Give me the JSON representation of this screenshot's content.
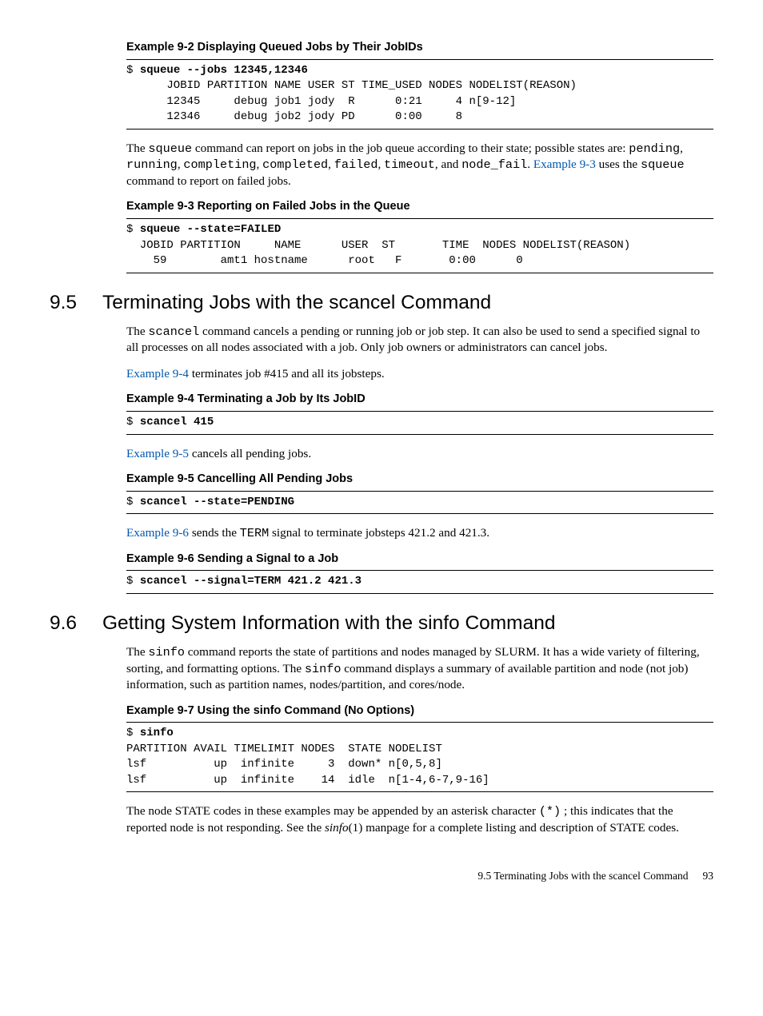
{
  "ex92": {
    "title": "Example 9-2  Displaying Queued Jobs by Their JobIDs",
    "cmd": "squeue --jobs 12345,12346",
    "out": "      JOBID PARTITION NAME USER ST TIME_USED NODES NODELIST(REASON)\n      12345     debug job1 jody  R      0:21     4 n[9-12]\n      12346     debug job2 jody PD      0:00     8"
  },
  "p_squeue_states": {
    "pre": "The ",
    "cmd1": "squeue",
    "mid1": " command can report on jobs in the job queue according to their state; possible states are: ",
    "s1": "pending",
    "s2": "running",
    "s3": "completing",
    "s4": "completed",
    "s5": "failed",
    "s6": "timeout",
    "s7": "node_fail",
    "mid2": ". ",
    "link": "Example 9-3",
    "mid3": " uses the ",
    "cmd2": "squeue",
    "tail": " command to report on failed jobs."
  },
  "ex93": {
    "title": "Example 9-3  Reporting on Failed Jobs in the Queue",
    "cmd": "squeue --state=FAILED",
    "out": "  JOBID PARTITION     NAME      USER  ST       TIME  NODES NODELIST(REASON)\n    59        amt1 hostname      root   F       0:00      0"
  },
  "sec95": {
    "num": "9.5",
    "title": "Terminating Jobs with the scancel Command"
  },
  "p_scancel_intro": {
    "pre": "The ",
    "cmd": "scancel",
    "tail": " command cancels a pending or running job or job step. It can also be used to send a specified signal to all processes on all nodes associated with a job. Only job owners or administrators can cancel jobs."
  },
  "p_ex94_ref": {
    "link": "Example 9-4",
    "tail": " terminates job #415 and all its jobsteps."
  },
  "ex94": {
    "title": "Example 9-4  Terminating a Job by Its JobID",
    "cmd": "scancel 415"
  },
  "p_ex95_ref": {
    "link": "Example 9-5",
    "tail": " cancels all pending jobs."
  },
  "ex95": {
    "title": "Example 9-5  Cancelling All Pending Jobs",
    "cmd": "scancel --state=PENDING"
  },
  "p_ex96_ref": {
    "link": "Example 9-6",
    "mid": " sends the ",
    "cmd": "TERM",
    "tail": " signal to terminate jobsteps 421.2 and 421.3."
  },
  "ex96": {
    "title": "Example 9-6  Sending a Signal to a Job",
    "cmd": "scancel --signal=TERM 421.2 421.3"
  },
  "sec96": {
    "num": "9.6",
    "title": "Getting System Information with the sinfo Command"
  },
  "p_sinfo_intro": {
    "pre": "The ",
    "cmd1": "sinfo",
    "mid": " command reports the state of partitions and nodes managed by SLURM. It has a wide variety of filtering, sorting, and formatting options. The ",
    "cmd2": "sinfo",
    "tail": " command displays a summary of available partition and node (not job) information, such as partition names, nodes/partition, and cores/node."
  },
  "ex97": {
    "title": "Example 9-7  Using the sinfo Command (No Options)",
    "cmd": "sinfo",
    "out": "PARTITION AVAIL TIMELIMIT NODES  STATE NODELIST\nlsf          up  infinite     3  down* n[0,5,8]\nlsf          up  infinite    14  idle  n[1-4,6-7,9-16]"
  },
  "p_state_note": {
    "pre": "The node STATE codes in these examples may be appended by an asterisk character ",
    "sym": "(*)",
    "mid": " ; this indicates that the reported node is not responding. See the ",
    "man": "sinfo",
    "tail": "(1) manpage for a complete listing and description of STATE codes."
  },
  "footer": {
    "label": "9.5 Terminating Jobs with the scancel Command",
    "page": "93"
  },
  "prompt": "$ "
}
